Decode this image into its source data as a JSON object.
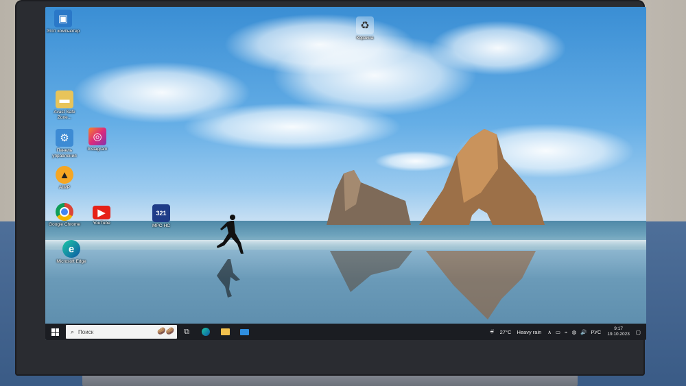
{
  "desktop": {
    "icons": [
      {
        "id": "this-pc",
        "label": "Этот компьютер",
        "icon": "computer-icon"
      },
      {
        "id": "recycle-bin",
        "label": "Корзина",
        "icon": "recycle-bin-icon"
      },
      {
        "id": "folder",
        "label": "Avast Safe Zone...",
        "icon": "folder-icon"
      },
      {
        "id": "control-panel",
        "label": "Панель управления",
        "icon": "control-panel-icon"
      },
      {
        "id": "instagram",
        "label": "Instagram",
        "icon": "instagram-icon"
      },
      {
        "id": "aimp",
        "label": "AIMP",
        "icon": "aimp-icon"
      },
      {
        "id": "chrome",
        "label": "Google Chrome",
        "icon": "chrome-icon"
      },
      {
        "id": "youtube",
        "label": "YouTube",
        "icon": "youtube-icon"
      },
      {
        "id": "mpc-hc",
        "label": "MPC-HC",
        "icon": "mpc-hc-icon"
      },
      {
        "id": "edge",
        "label": "Microsoft Edge",
        "icon": "edge-icon"
      }
    ]
  },
  "taskbar": {
    "search_placeholder": "Поиск",
    "pinned": [
      "task-view-icon",
      "edge-icon",
      "file-explorer-icon",
      "mail-icon"
    ],
    "weather": {
      "temp": "27°C",
      "condition": "Heavy rain"
    },
    "language": "РУС",
    "time": "9:17",
    "date": "19.10.2023"
  },
  "colors": {
    "taskbar": "#1b1d22",
    "accent": "#0078d4"
  }
}
